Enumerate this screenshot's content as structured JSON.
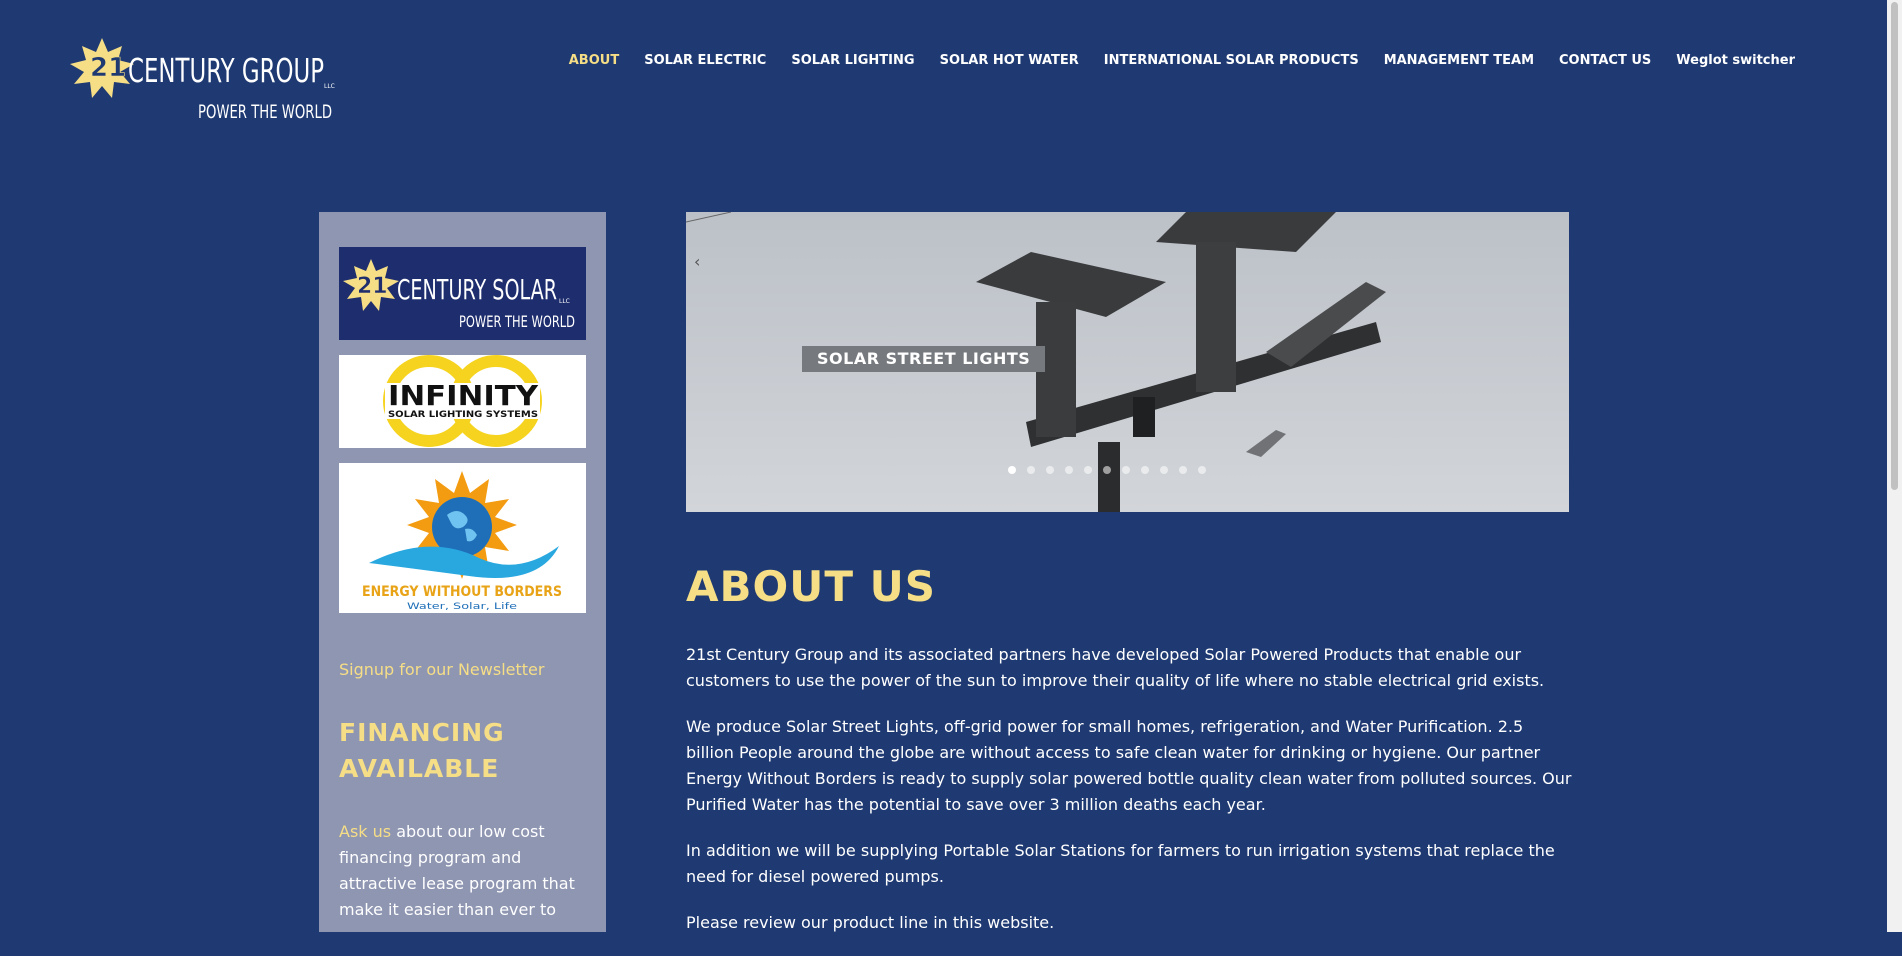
{
  "header": {
    "logo_text": "21st CENTURY GROUP LLC — POWER THE WORLD",
    "nav": [
      {
        "label": "ABOUT",
        "active": true
      },
      {
        "label": "SOLAR ELECTRIC",
        "active": false
      },
      {
        "label": "SOLAR LIGHTING",
        "active": false
      },
      {
        "label": "SOLAR HOT WATER",
        "active": false
      },
      {
        "label": "INTERNATIONAL SOLAR PRODUCTS",
        "active": false
      },
      {
        "label": "MANAGEMENT TEAM",
        "active": false
      },
      {
        "label": "CONTACT US",
        "active": false
      },
      {
        "label": "Weglot switcher",
        "active": false
      }
    ]
  },
  "sidebar": {
    "logos": [
      {
        "alt": "21st Century Solar LLC — Power the World"
      },
      {
        "alt": "Infinity Solar Lighting Systems"
      },
      {
        "alt": "Energy Without Borders — Water, Solar, Life"
      }
    ],
    "newsletter_link": "Signup for our Newsletter",
    "financing_heading": "FINANCING AVAILABLE",
    "financing_link": "Ask us",
    "financing_text": " about our low cost financing program and attractive lease program that make it easier than ever to own"
  },
  "slider": {
    "caption": "SOLAR STREET LIGHTS",
    "slide_count": 11,
    "active_index": 0
  },
  "main": {
    "title": "ABOUT US",
    "paragraphs": [
      "21st Century Group and its associated partners have developed Solar Powered Products that enable our customers to use the power of the sun to improve their quality of life where no stable electrical grid exists.",
      "We produce Solar Street Lights, off-grid power for small homes, refrigeration, and Water Purification. 2.5 billion People around the globe are without access to safe clean water for drinking or hygiene. Our partner Energy Without Borders is ready to supply solar powered bottle quality clean water from polluted sources. Our Purified Water has the potential to save over 3 million deaths each year.",
      "In addition we will be supplying Portable Solar Stations for farmers to run irrigation systems that replace the need for diesel powered pumps.",
      "Please review our product line in this website."
    ]
  },
  "colors": {
    "background": "#1f3a72",
    "accent": "#f6de86",
    "sidebar": "#8f96b2"
  }
}
